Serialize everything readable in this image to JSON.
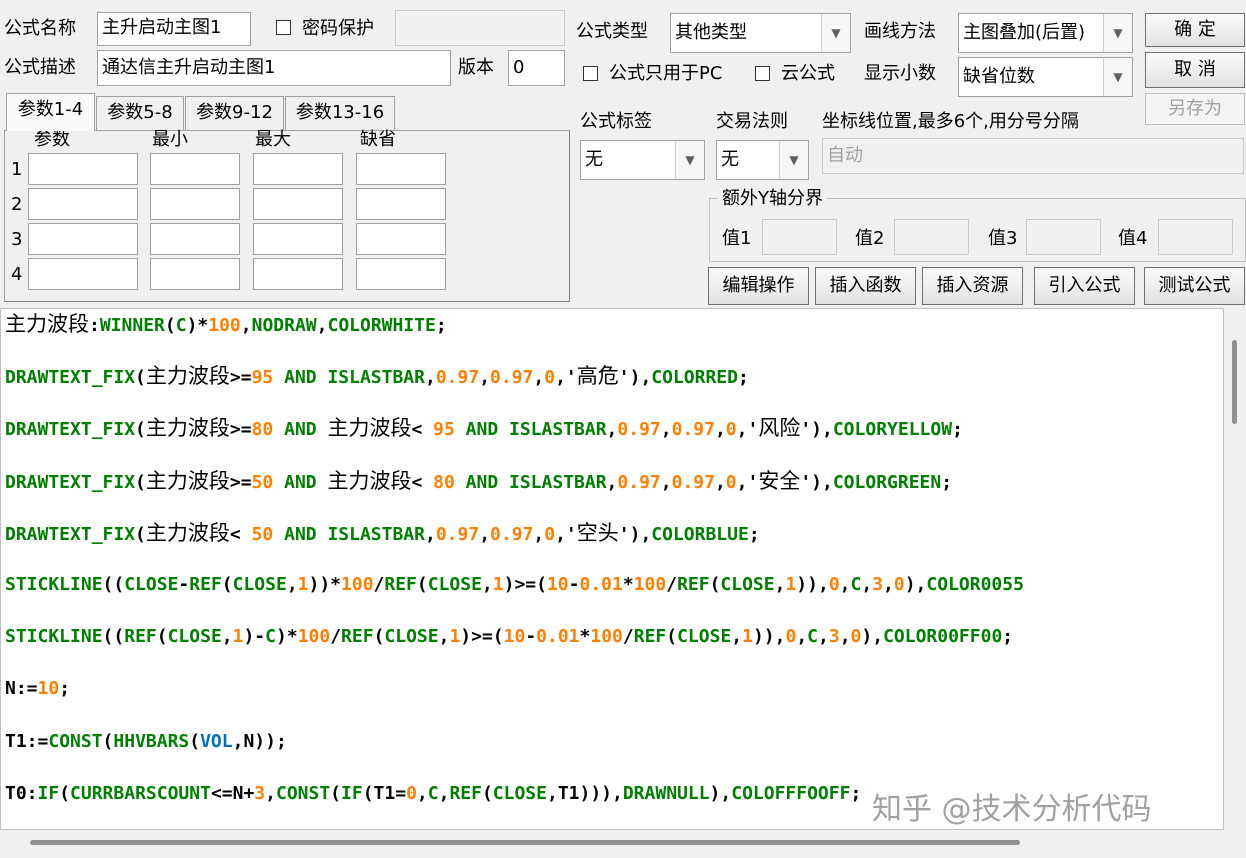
{
  "formula": {
    "name_label": "公式名称",
    "name_value": "主升启动主图1",
    "password_label": "密码保护",
    "password_value": "",
    "desc_label": "公式描述",
    "desc_value": "通达信主升启动主图1",
    "version_label": "版本",
    "version_value": "0",
    "type_label": "公式类型",
    "type_value": "其他类型",
    "draw_label": "画线方法",
    "draw_value": "主图叠加(后置)",
    "pc_only_label": "公式只用于PC",
    "cloud_label": "云公式",
    "decimal_label": "显示小数",
    "decimal_value": "缺省位数",
    "tag_label": "公式标签",
    "tag_value": "无",
    "rule_label": "交易法则",
    "rule_value": "无",
    "axis_label": "坐标线位置,最多6个,用分号分隔",
    "axis_value": "自动"
  },
  "buttons": {
    "ok": "确  定",
    "cancel": "取  消",
    "save_as": "另存为",
    "edit": "编辑操作",
    "insert_fn": "插入函数",
    "insert_res": "插入资源",
    "import": "引入公式",
    "test": "测试公式"
  },
  "tabs": [
    "参数1-4",
    "参数5-8",
    "参数9-12",
    "参数13-16"
  ],
  "params": {
    "headers": [
      "参数",
      "最小",
      "最大",
      "缺省"
    ],
    "rows": [
      "1",
      "2",
      "3",
      "4"
    ]
  },
  "yaxis": {
    "title": "额外Y轴分界",
    "labels": [
      "值1",
      "值2",
      "值3",
      "值4"
    ]
  },
  "code_lines": [
    [
      [
        "d",
        "主力波段"
      ],
      [
        "o",
        ":"
      ],
      [
        "f",
        "WINNER"
      ],
      [
        "o",
        "("
      ],
      [
        "f",
        "C"
      ],
      [
        "o",
        ")*"
      ],
      [
        "n",
        "100"
      ],
      [
        "o",
        ","
      ],
      [
        "f",
        "NODRAW"
      ],
      [
        "o",
        ","
      ],
      [
        "f",
        "COLORWHITE"
      ],
      [
        "o",
        ";"
      ]
    ],
    [
      [
        "f",
        "DRAWTEXT_FIX"
      ],
      [
        "o",
        "("
      ],
      [
        "d",
        "主力波段"
      ],
      [
        "o",
        ">="
      ],
      [
        "n",
        "95"
      ],
      [
        "f",
        " AND ISLASTBAR"
      ],
      [
        "o",
        ","
      ],
      [
        "n",
        "0.97"
      ],
      [
        "o",
        ","
      ],
      [
        "n",
        "0.97"
      ],
      [
        "o",
        ","
      ],
      [
        "n",
        "0"
      ],
      [
        "o",
        ",'"
      ],
      [
        "d",
        "高危"
      ],
      [
        "o",
        "'),"
      ],
      [
        "f",
        "COLORRED"
      ],
      [
        "o",
        ";"
      ]
    ],
    [
      [
        "f",
        "DRAWTEXT_FIX"
      ],
      [
        "o",
        "("
      ],
      [
        "d",
        "主力波段"
      ],
      [
        "o",
        ">="
      ],
      [
        "n",
        "80"
      ],
      [
        "f",
        " AND "
      ],
      [
        "d",
        "主力波段"
      ],
      [
        "o",
        "< "
      ],
      [
        "n",
        "95"
      ],
      [
        "f",
        " AND ISLASTBAR"
      ],
      [
        "o",
        ","
      ],
      [
        "n",
        "0.97"
      ],
      [
        "o",
        ","
      ],
      [
        "n",
        "0.97"
      ],
      [
        "o",
        ","
      ],
      [
        "n",
        "0"
      ],
      [
        "o",
        ",'"
      ],
      [
        "d",
        "风险"
      ],
      [
        "o",
        "'),"
      ],
      [
        "f",
        "COLORYELLOW"
      ],
      [
        "o",
        ";"
      ]
    ],
    [
      [
        "f",
        "DRAWTEXT_FIX"
      ],
      [
        "o",
        "("
      ],
      [
        "d",
        "主力波段"
      ],
      [
        "o",
        ">="
      ],
      [
        "n",
        "50"
      ],
      [
        "f",
        " AND "
      ],
      [
        "d",
        "主力波段"
      ],
      [
        "o",
        "< "
      ],
      [
        "n",
        "80"
      ],
      [
        "f",
        " AND ISLASTBAR"
      ],
      [
        "o",
        ","
      ],
      [
        "n",
        "0.97"
      ],
      [
        "o",
        ","
      ],
      [
        "n",
        "0.97"
      ],
      [
        "o",
        ","
      ],
      [
        "n",
        "0"
      ],
      [
        "o",
        ",'"
      ],
      [
        "d",
        "安全"
      ],
      [
        "o",
        "'),"
      ],
      [
        "f",
        "COLORGREEN"
      ],
      [
        "o",
        ";"
      ]
    ],
    [
      [
        "f",
        "DRAWTEXT_FIX"
      ],
      [
        "o",
        "("
      ],
      [
        "d",
        "主力波段"
      ],
      [
        "o",
        "< "
      ],
      [
        "n",
        "50"
      ],
      [
        "f",
        " AND ISLASTBAR"
      ],
      [
        "o",
        ","
      ],
      [
        "n",
        "0.97"
      ],
      [
        "o",
        ","
      ],
      [
        "n",
        "0.97"
      ],
      [
        "o",
        ","
      ],
      [
        "n",
        "0"
      ],
      [
        "o",
        ",'"
      ],
      [
        "d",
        "空头"
      ],
      [
        "o",
        "'),"
      ],
      [
        "f",
        "COLORBLUE"
      ],
      [
        "o",
        ";"
      ]
    ],
    [
      [
        "f",
        "STICKLINE"
      ],
      [
        "o",
        "(("
      ],
      [
        "f",
        "CLOSE"
      ],
      [
        "o",
        "-"
      ],
      [
        "f",
        "REF"
      ],
      [
        "o",
        "("
      ],
      [
        "f",
        "CLOSE"
      ],
      [
        "o",
        ","
      ],
      [
        "n",
        "1"
      ],
      [
        "o",
        "))*"
      ],
      [
        "n",
        "100"
      ],
      [
        "o",
        "/"
      ],
      [
        "f",
        "REF"
      ],
      [
        "o",
        "("
      ],
      [
        "f",
        "CLOSE"
      ],
      [
        "o",
        ","
      ],
      [
        "n",
        "1"
      ],
      [
        "o",
        ")>=("
      ],
      [
        "n",
        "10"
      ],
      [
        "o",
        "-"
      ],
      [
        "n",
        "0.01"
      ],
      [
        "o",
        "*"
      ],
      [
        "n",
        "100"
      ],
      [
        "o",
        "/"
      ],
      [
        "f",
        "REF"
      ],
      [
        "o",
        "("
      ],
      [
        "f",
        "CLOSE"
      ],
      [
        "o",
        ","
      ],
      [
        "n",
        "1"
      ],
      [
        "o",
        ")),"
      ],
      [
        "n",
        "0"
      ],
      [
        "o",
        ","
      ],
      [
        "f",
        "C"
      ],
      [
        "o",
        ","
      ],
      [
        "n",
        "3"
      ],
      [
        "o",
        ","
      ],
      [
        "n",
        "0"
      ],
      [
        "o",
        "),"
      ],
      [
        "f",
        "COLOR0055"
      ]
    ],
    [
      [
        "f",
        "STICKLINE"
      ],
      [
        "o",
        "(("
      ],
      [
        "f",
        "REF"
      ],
      [
        "o",
        "("
      ],
      [
        "f",
        "CLOSE"
      ],
      [
        "o",
        ","
      ],
      [
        "n",
        "1"
      ],
      [
        "o",
        ")-"
      ],
      [
        "f",
        "C"
      ],
      [
        "o",
        ")*"
      ],
      [
        "n",
        "100"
      ],
      [
        "o",
        "/"
      ],
      [
        "f",
        "REF"
      ],
      [
        "o",
        "("
      ],
      [
        "f",
        "CLOSE"
      ],
      [
        "o",
        ","
      ],
      [
        "n",
        "1"
      ],
      [
        "o",
        ")>=("
      ],
      [
        "n",
        "10"
      ],
      [
        "o",
        "-"
      ],
      [
        "n",
        "0.01"
      ],
      [
        "o",
        "*"
      ],
      [
        "n",
        "100"
      ],
      [
        "o",
        "/"
      ],
      [
        "f",
        "REF"
      ],
      [
        "o",
        "("
      ],
      [
        "f",
        "CLOSE"
      ],
      [
        "o",
        ","
      ],
      [
        "n",
        "1"
      ],
      [
        "o",
        ")),"
      ],
      [
        "n",
        "0"
      ],
      [
        "o",
        ","
      ],
      [
        "f",
        "C"
      ],
      [
        "o",
        ","
      ],
      [
        "n",
        "3"
      ],
      [
        "o",
        ","
      ],
      [
        "n",
        "0"
      ],
      [
        "o",
        "),"
      ],
      [
        "f",
        "COLOR00FF00"
      ],
      [
        "o",
        ";"
      ]
    ],
    [
      [
        "o",
        "N:="
      ],
      [
        "n",
        "10"
      ],
      [
        "o",
        ";"
      ]
    ],
    [
      [
        "o",
        "T1:="
      ],
      [
        "f",
        "CONST"
      ],
      [
        "o",
        "("
      ],
      [
        "f",
        "HHVBARS"
      ],
      [
        "o",
        "("
      ],
      [
        "k",
        "VOL"
      ],
      [
        "o",
        ",N));"
      ]
    ],
    [
      [
        "o",
        "T0:"
      ],
      [
        "f",
        "IF"
      ],
      [
        "o",
        "("
      ],
      [
        "f",
        "CURRBARSCOUNT"
      ],
      [
        "o",
        "<=N+"
      ],
      [
        "n",
        "3"
      ],
      [
        "o",
        ","
      ],
      [
        "f",
        "CONST"
      ],
      [
        "o",
        "("
      ],
      [
        "f",
        "IF"
      ],
      [
        "o",
        "(T1="
      ],
      [
        "n",
        "0"
      ],
      [
        "o",
        ","
      ],
      [
        "f",
        "C"
      ],
      [
        "o",
        ","
      ],
      [
        "f",
        "REF"
      ],
      [
        "o",
        "("
      ],
      [
        "f",
        "CLOSE"
      ],
      [
        "o",
        ",T1))),"
      ],
      [
        "f",
        "DRAWNULL"
      ],
      [
        "o",
        "),"
      ],
      [
        "f",
        "COLOFFFOOFF"
      ],
      [
        "o",
        ";"
      ]
    ]
  ],
  "watermark": "知乎 @技术分析代码"
}
